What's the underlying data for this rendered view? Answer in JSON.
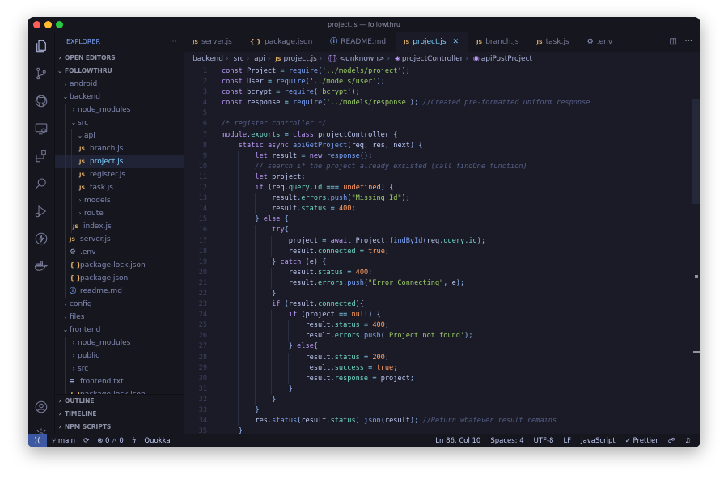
{
  "window": {
    "title": "project.js — followthru"
  },
  "sidebar": {
    "explorer_label": "EXPLORER",
    "more": "···",
    "open_editors": "OPEN EDITORS",
    "workspace": "FOLLOWTHRU",
    "tree": [
      {
        "label": "android",
        "type": "folder"
      },
      {
        "label": "backend",
        "type": "folder-open"
      },
      {
        "label": "node_modules",
        "type": "folder"
      },
      {
        "label": "src",
        "type": "folder-open"
      },
      {
        "label": "api",
        "type": "folder-open"
      },
      {
        "label": "branch.js",
        "type": "js"
      },
      {
        "label": "project.js",
        "type": "js",
        "selected": true
      },
      {
        "label": "register.js",
        "type": "js"
      },
      {
        "label": "task.js",
        "type": "js"
      },
      {
        "label": "models",
        "type": "folder"
      },
      {
        "label": "route",
        "type": "folder"
      },
      {
        "label": "index.js",
        "type": "js"
      },
      {
        "label": "server.js",
        "type": "js"
      },
      {
        "label": ".env",
        "type": "gear"
      },
      {
        "label": "package-lock.json",
        "type": "json"
      },
      {
        "label": "package.json",
        "type": "json"
      },
      {
        "label": "readme.md",
        "type": "info"
      },
      {
        "label": "config",
        "type": "folder"
      },
      {
        "label": "files",
        "type": "folder"
      },
      {
        "label": "frontend",
        "type": "folder-open"
      },
      {
        "label": "node_modules",
        "type": "folder"
      },
      {
        "label": "public",
        "type": "folder"
      },
      {
        "label": "src",
        "type": "folder"
      },
      {
        "label": "frontend.txt",
        "type": "txt"
      },
      {
        "label": "package-lock.json",
        "type": "json"
      }
    ],
    "outline": "OUTLINE",
    "timeline": "TIMELINE",
    "npm_scripts": "NPM SCRIPTS"
  },
  "tabs": [
    {
      "label": "server.js",
      "icon": "js"
    },
    {
      "label": "package.json",
      "icon": "json"
    },
    {
      "label": "README.md",
      "icon": "info"
    },
    {
      "label": "project.js",
      "icon": "js",
      "active": true
    },
    {
      "label": "branch.js",
      "icon": "js"
    },
    {
      "label": "task.js",
      "icon": "js"
    },
    {
      "label": ".env",
      "icon": "gear"
    }
  ],
  "icons": {
    "js": "JS",
    "json": "{ }",
    "info": "ⓘ",
    "gear": "⚙",
    "txt": "≡",
    "close": "✕",
    "split": "◫",
    "more": "···"
  },
  "breadcrumb": [
    "backend",
    "src",
    "api",
    "project.js",
    "<unknown>",
    "projectController",
    "apiPostProject"
  ],
  "code_lines": [
    "const Project = require('../models/project');",
    "const User = require('../models/user');",
    "const bcrypt = require('bcrypt');",
    "const response = require('../models/response'); //Created pre-formatted uniform response",
    "",
    "/* register controller */",
    "module.exports = class projectController {",
    "    static async apiGetProject(req, res, next) {",
    "        let result = new response();",
    "        // search if the project already exsisted (call findOne function)",
    "        let project;",
    "        if (req.query.id === undefined) {",
    "            result.errors.push(\"Missing Id\");",
    "            result.status = 400;",
    "        } else {",
    "            try{",
    "                project = await Project.findById(req.query.id);",
    "                result.connected = true;",
    "            } catch (e) {",
    "                result.status = 400;",
    "                result.errors.push(\"Error Connecting\", e);",
    "            }",
    "            if (result.connected){",
    "                if (project == null) {",
    "                    result.status = 400;",
    "                    result.errors.push('Project not found');",
    "                } else{",
    "                    result.status = 200;",
    "                    result.success = true;",
    "                    result.response = project;",
    "                }",
    "            }",
    "        }",
    "        res.status(result.status).json(result); //Return whatever result remains",
    "    }"
  ],
  "status": {
    "branch": "main",
    "errors": "0",
    "warnings": "0",
    "quokka": "Quokka",
    "position": "Ln 86, Col 10",
    "spaces": "Spaces: 4",
    "encoding": "UTF-8",
    "eol": "LF",
    "language": "JavaScript",
    "prettier": "✓ Prettier"
  },
  "colors": {
    "accent": "#7dcfff",
    "background": "#1a1b26",
    "sidebar": "#16161e",
    "remote": "#3d59a1"
  }
}
